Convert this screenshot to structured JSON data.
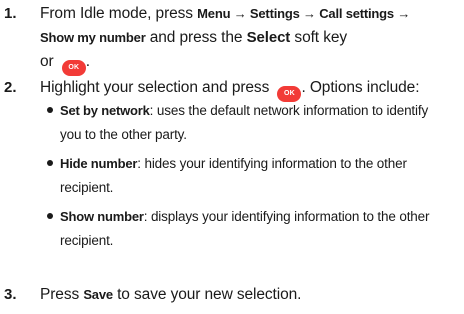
{
  "steps": [
    {
      "number": "1.",
      "lead": "From Idle mode, press ",
      "path": "Menu → Settings → Call settings →",
      "path2": "Show my number",
      "and_press": " and press the ",
      "select_label": "Select",
      "soft_key": " soft key",
      "or": "or ",
      "ok_icon": "OK",
      "end": "."
    },
    {
      "number": "2.",
      "lead": "Highlight your selection and press ",
      "ok_icon": "OK",
      "tail": ". Options include:",
      "options": [
        {
          "term": "Set by network",
          "desc_line1": ": uses the default network information to identify",
          "desc_line2": "you to the other party."
        },
        {
          "term": "Hide number",
          "desc_line1": ": hides your identifying information to the other",
          "desc_line2": "recipient."
        },
        {
          "term": "Show number",
          "desc_line1": ": displays your identifying information to the other",
          "desc_line2": "recipient."
        }
      ]
    },
    {
      "number": "3.",
      "lead": "Press ",
      "save_label": "Save",
      "tail": " to save your new selection."
    }
  ],
  "colors": {
    "ok_button": "#f23b37",
    "text": "#1a1a1a"
  }
}
